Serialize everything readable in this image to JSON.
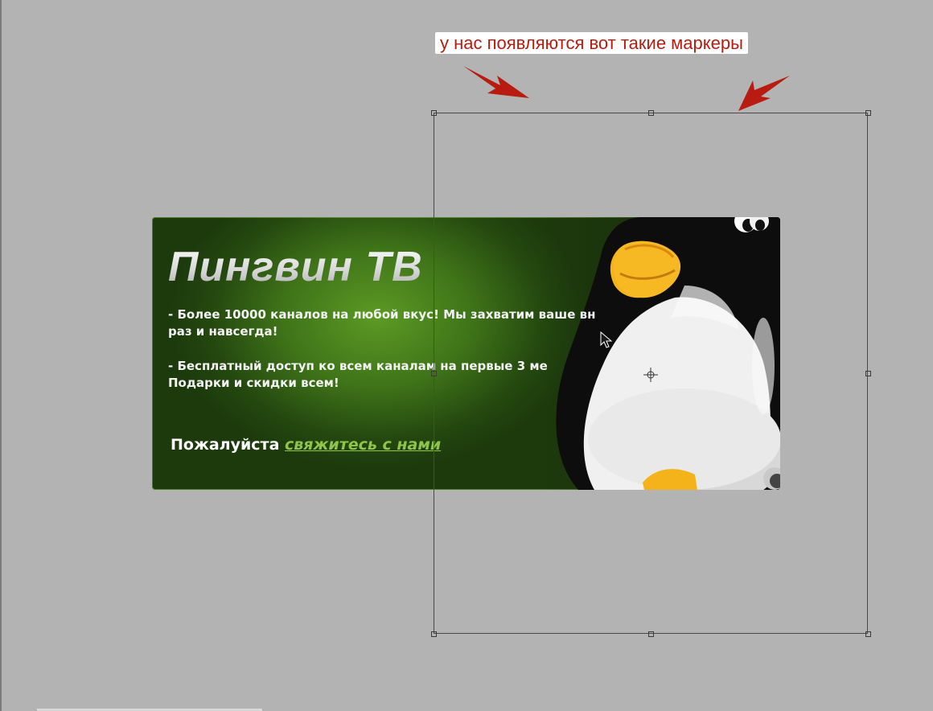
{
  "annotation": {
    "text": "у нас появляются вот такие маркеры",
    "color": "#b81c10"
  },
  "banner": {
    "title": "Пингвин ТВ",
    "line1": "- Более 10000 каналов на любой вкус! Мы захватим ваше вн\nраз и навсегда!",
    "line2": "-  Бесплатный доступ ко всем каналам на первые 3 ме\nПодарки и скидки всем!",
    "contact_prefix": "Пожалуйста ",
    "contact_link": "свяжитесь с нами",
    "accent_green": "#8fc44a"
  },
  "transform_box": {
    "icons": [
      "handle-icon",
      "pivot-icon",
      "cursor-icon"
    ]
  }
}
